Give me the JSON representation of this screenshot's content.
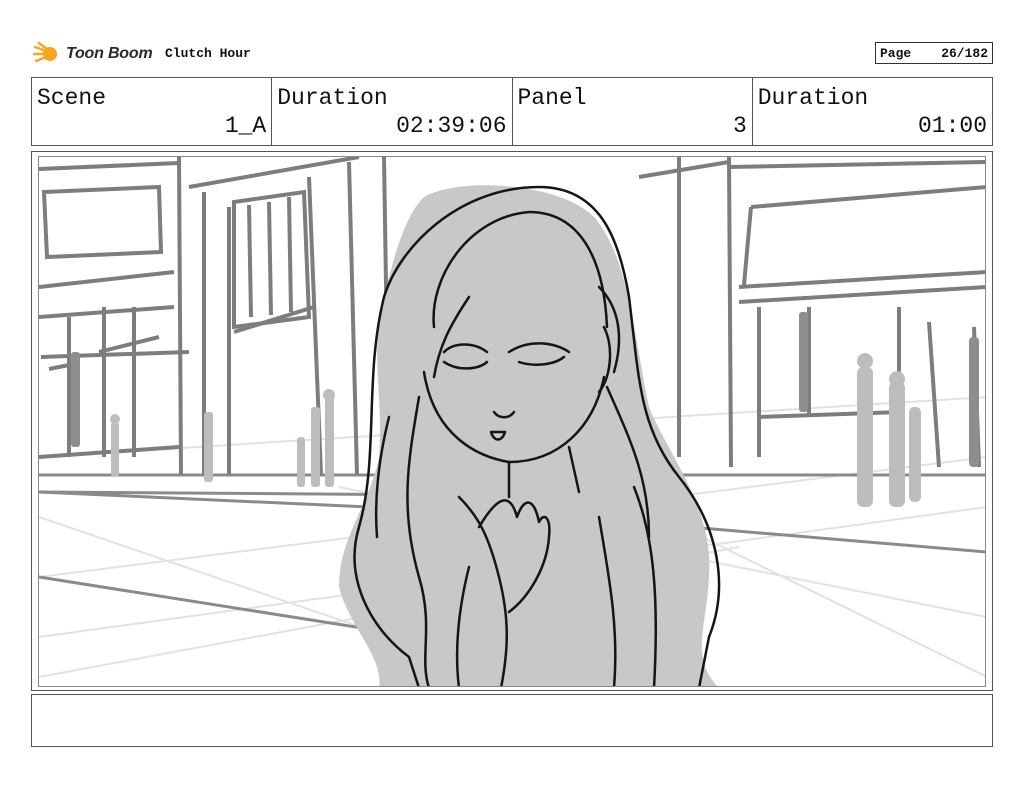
{
  "header": {
    "logo_text": "Toon Boom",
    "project_title": "Clutch Hour",
    "page_label": "Page",
    "page_number": "26/182"
  },
  "info": [
    {
      "label": "Scene",
      "value": "1_A"
    },
    {
      "label": "Duration",
      "value": "02:39:06"
    },
    {
      "label": "Panel",
      "value": "3"
    },
    {
      "label": "Duration",
      "value": "01:00"
    }
  ],
  "colors": {
    "logo_orange": "#f5a623",
    "sketch_dark": "#151515",
    "sketch_mid": "#7a7a7a",
    "sketch_light": "#c4c4c4",
    "character_fill": "#c8c8c8"
  },
  "notes": ""
}
